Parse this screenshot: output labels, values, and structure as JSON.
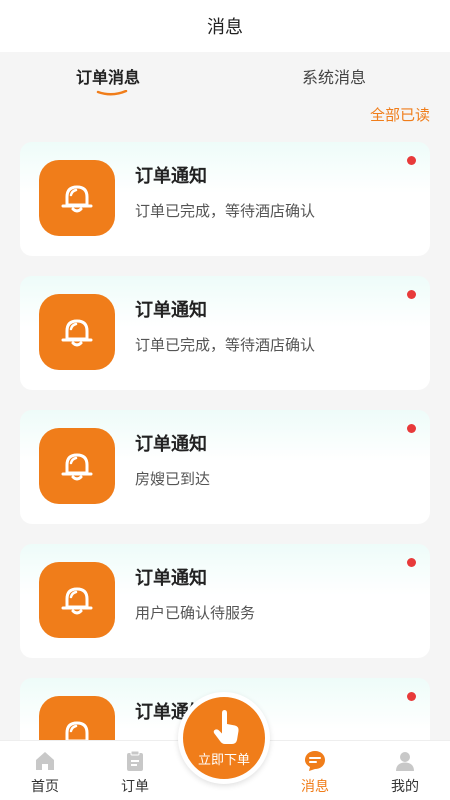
{
  "header": {
    "title": "消息"
  },
  "tabs": [
    {
      "label": "订单消息",
      "active": true
    },
    {
      "label": "系统消息",
      "active": false
    }
  ],
  "mark_all_read": "全部已读",
  "messages": [
    {
      "title": "订单通知",
      "desc": "订单已完成，等待酒店确认",
      "unread": true
    },
    {
      "title": "订单通知",
      "desc": "订单已完成，等待酒店确认",
      "unread": true
    },
    {
      "title": "订单通知",
      "desc": "房嫂已到达",
      "unread": true
    },
    {
      "title": "订单通知",
      "desc": "用户已确认待服务",
      "unread": true
    },
    {
      "title": "订单通知",
      "desc": "",
      "unread": true
    }
  ],
  "tabbar": {
    "items": [
      {
        "label": "首页",
        "icon": "home-icon"
      },
      {
        "label": "订单",
        "icon": "clipboard-icon"
      },
      {
        "label": "消息",
        "icon": "message-icon",
        "active": true
      },
      {
        "label": "我的",
        "icon": "user-icon"
      }
    ],
    "center": {
      "label": "立即下单",
      "icon": "tap-hand-icon"
    }
  },
  "colors": {
    "accent": "#f07d1a",
    "unread_dot": "#e83a3a",
    "inactive_icon": "#c8c8c8"
  }
}
